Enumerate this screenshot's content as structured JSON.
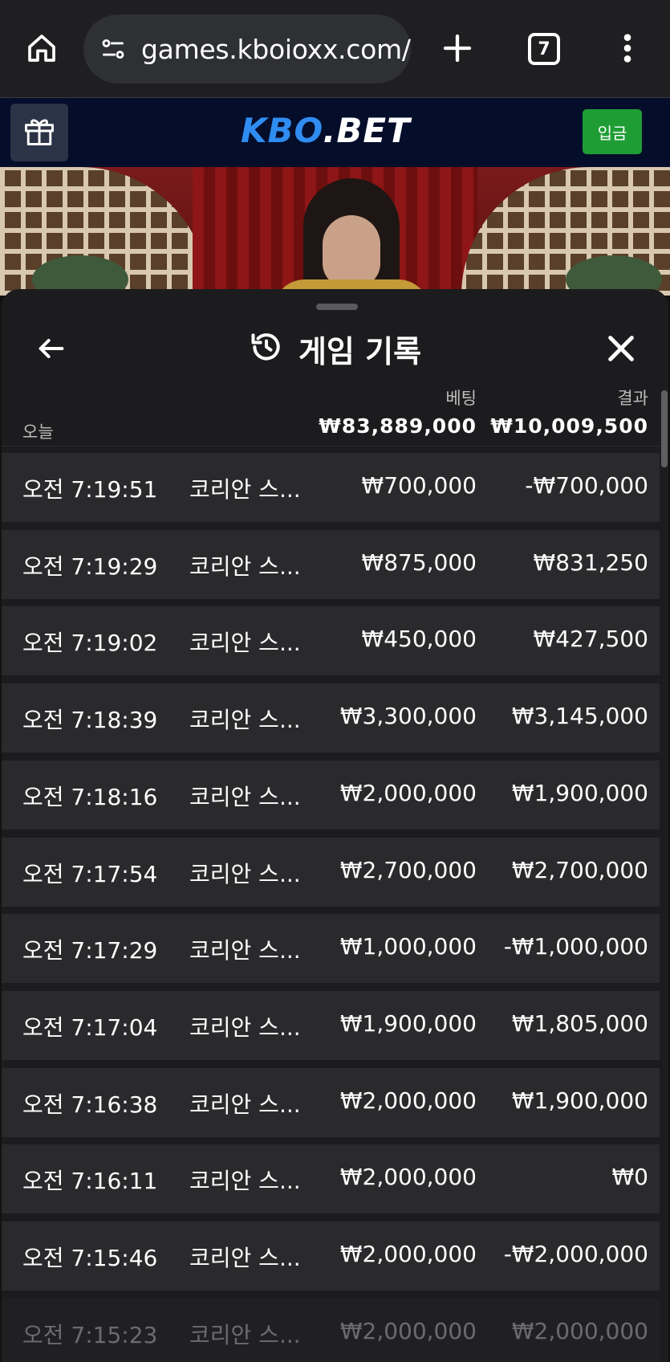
{
  "browser": {
    "url": "games.kboioxx.com/",
    "tab_count": "7"
  },
  "site": {
    "logo_main": "KBO",
    "logo_dot": ".",
    "logo_suffix": "BET",
    "deposit_label": "입금",
    "brand_color": "#2f8cf0",
    "deposit_color": "#1f9d35"
  },
  "sheet": {
    "title": "게임 기록",
    "today_label": "오늘",
    "bet_header": "베팅",
    "result_header": "결과",
    "bet_total": "₩83,889,000",
    "result_total": "₩10,009,500"
  },
  "rows": [
    {
      "time": "오전 7:19:51",
      "game": "코리안 스...",
      "bet": "₩700,000",
      "result": "-₩700,000"
    },
    {
      "time": "오전 7:19:29",
      "game": "코리안 스...",
      "bet": "₩875,000",
      "result": "₩831,250"
    },
    {
      "time": "오전 7:19:02",
      "game": "코리안 스...",
      "bet": "₩450,000",
      "result": "₩427,500"
    },
    {
      "time": "오전 7:18:39",
      "game": "코리안 스...",
      "bet": "₩3,300,000",
      "result": "₩3,145,000"
    },
    {
      "time": "오전 7:18:16",
      "game": "코리안 스...",
      "bet": "₩2,000,000",
      "result": "₩1,900,000"
    },
    {
      "time": "오전 7:17:54",
      "game": "코리안 스...",
      "bet": "₩2,700,000",
      "result": "₩2,700,000"
    },
    {
      "time": "오전 7:17:29",
      "game": "코리안 스...",
      "bet": "₩1,000,000",
      "result": "-₩1,000,000"
    },
    {
      "time": "오전 7:17:04",
      "game": "코리안 스...",
      "bet": "₩1,900,000",
      "result": "₩1,805,000"
    },
    {
      "time": "오전 7:16:38",
      "game": "코리안 스...",
      "bet": "₩2,000,000",
      "result": "₩1,900,000"
    },
    {
      "time": "오전 7:16:11",
      "game": "코리안 스...",
      "bet": "₩2,000,000",
      "result": "₩0"
    },
    {
      "time": "오전 7:15:46",
      "game": "코리안 스...",
      "bet": "₩2,000,000",
      "result": "-₩2,000,000"
    },
    {
      "time": "오전 7:15:23",
      "game": "코리안 스...",
      "bet": "₩2,000,000",
      "result": "₩2,000,000"
    }
  ],
  "icons": {
    "home": "home-icon",
    "site_info": "tune-icon",
    "new_tab": "plus-icon",
    "menu": "more-vertical-icon",
    "gift": "gift-icon",
    "back": "arrow-left-icon",
    "history": "history-icon",
    "close": "close-icon"
  }
}
